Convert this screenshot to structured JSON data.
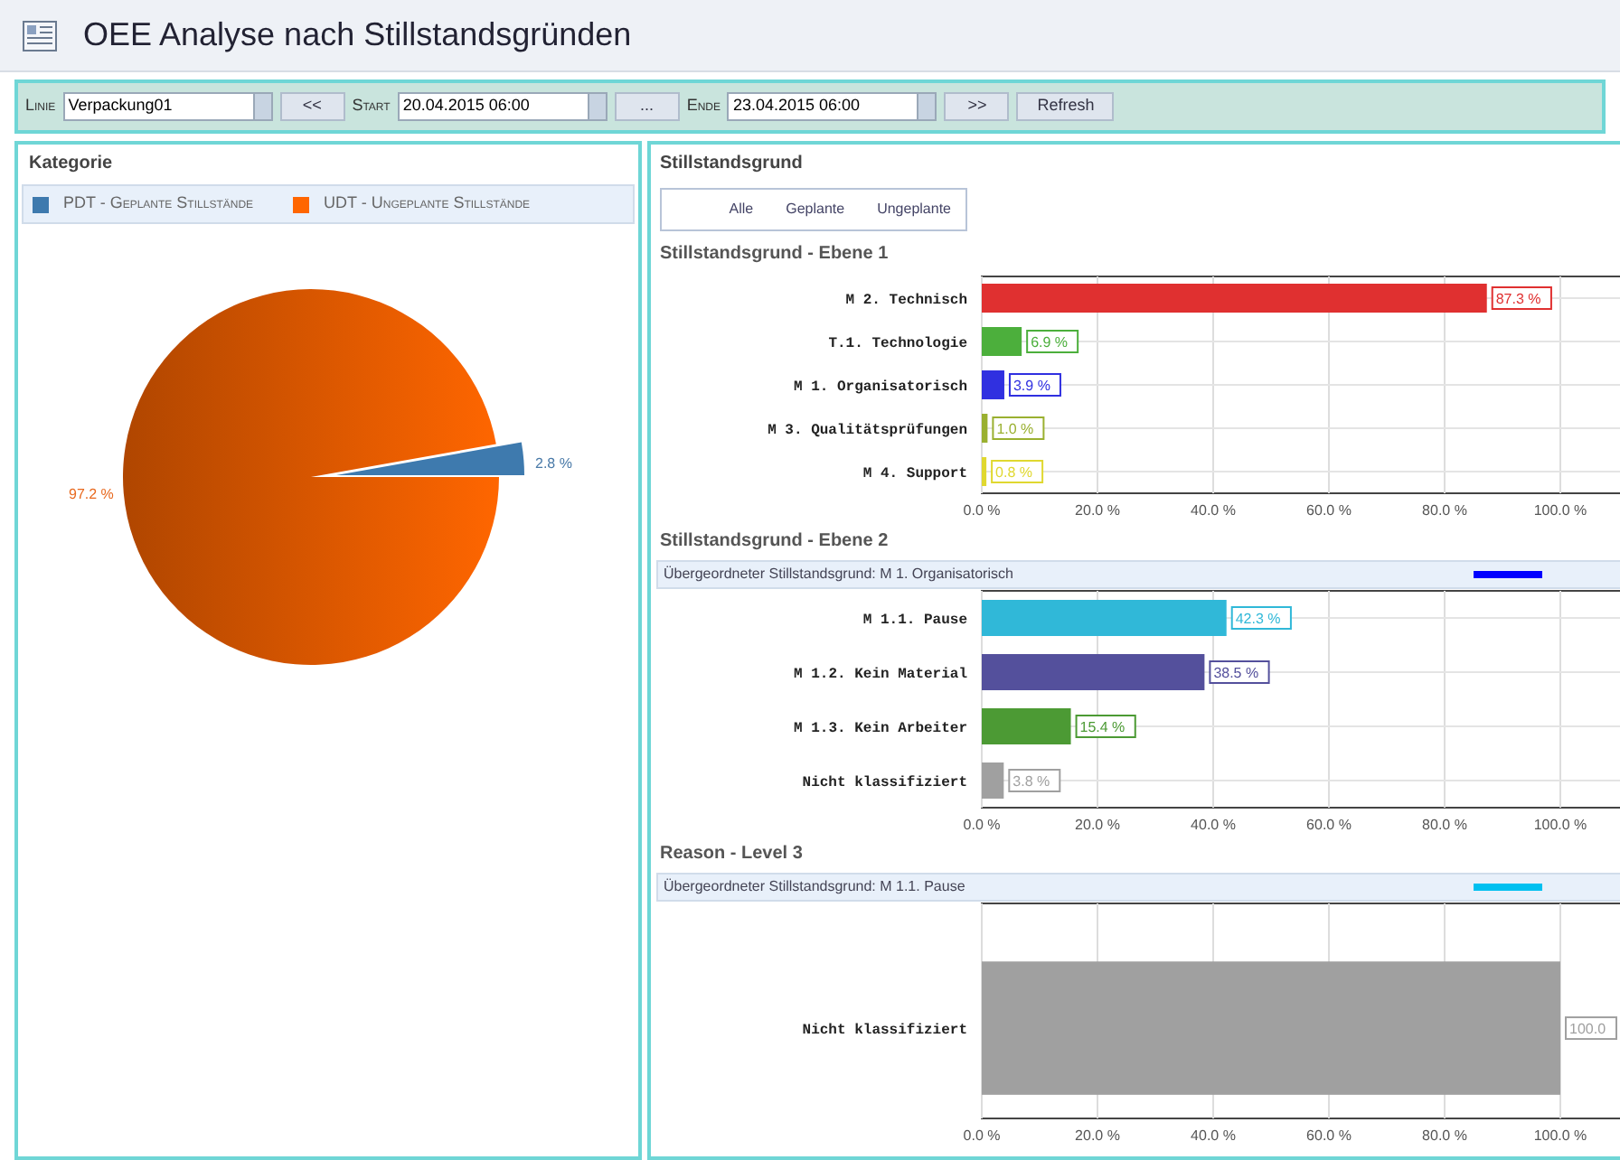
{
  "window": {
    "title": "OEE Analyse nach Stillstandsgründen"
  },
  "toolbar": {
    "line_label": "Linie",
    "line_value": "Verpackung01",
    "prev_button": "<<",
    "start_label": "Start",
    "start_value": "20.04.2015 06:00",
    "pick_button": "...",
    "end_label": "Ende",
    "end_value": "23.04.2015 06:00",
    "next_button": ">>",
    "refresh_button": "Refresh"
  },
  "category_panel": {
    "title": "Kategorie",
    "legend": [
      {
        "label": "PDT - Geplante Stillstände",
        "color": "#3e7aae"
      },
      {
        "label": "UDT - Ungeplante Stillstände",
        "color": "#ff6600"
      }
    ],
    "chart_data": {
      "type": "pie",
      "values": [
        2.8,
        97.2
      ],
      "value_labels": [
        "2.8 %",
        "97.2 %"
      ]
    }
  },
  "reason_panel": {
    "title": "Stillstandsgrund",
    "filters": [
      "Alle",
      "Geplante",
      "Ungeplante"
    ],
    "sections": [
      {
        "title": "Stillstandsgrund - Ebene 1",
        "chart_data": {
          "type": "bar",
          "orientation": "horizontal",
          "categories": [
            "M 2. Technisch",
            "T.1. Technologie",
            "M 1. Organisatorisch",
            "M 3. Qualitätsprüfungen",
            "M 4. Support"
          ],
          "values": [
            87.3,
            6.9,
            3.9,
            1.0,
            0.8
          ],
          "colors": [
            "#e03030",
            "#4caf3c",
            "#3030e0",
            "#9ab030",
            "#e0d830"
          ],
          "value_labels": [
            "87.3 %",
            "6.9 %",
            "3.9 %",
            "1.0 %",
            "0.8 %"
          ],
          "grid": true,
          "xlim": [
            0,
            112.5
          ],
          "xticks": [
            {
              "value": 0,
              "label": "0.0 %"
            },
            {
              "value": 20,
              "label": "20.0 %"
            },
            {
              "value": 40,
              "label": "40.0 %"
            },
            {
              "value": 60,
              "label": "60.0 %"
            },
            {
              "value": 80,
              "label": "80.0 %"
            },
            {
              "value": 100,
              "label": "100.0 %"
            }
          ]
        }
      },
      {
        "title": "Stillstandsgrund - Ebene 2",
        "parent": {
          "label": "Übergeordneter Stillstandsgrund: M 1. Organisatorisch",
          "color": "#0000ff"
        },
        "chart_data": {
          "type": "bar",
          "orientation": "horizontal",
          "categories": [
            "M 1.1. Pause",
            "M 1.2. Kein Material",
            "M 1.3. Kein Arbeiter",
            "Nicht klassifiziert"
          ],
          "values": [
            42.3,
            38.5,
            15.4,
            3.8
          ],
          "colors": [
            "#30b8d8",
            "#54509c",
            "#4c9a34",
            "#a0a0a0"
          ],
          "value_labels": [
            "42.3 %",
            "38.5 %",
            "15.4 %",
            "3.8 %"
          ],
          "grid": true,
          "xlim": [
            0,
            112.5
          ],
          "xticks": [
            {
              "value": 0,
              "label": "0.0 %"
            },
            {
              "value": 20,
              "label": "20.0 %"
            },
            {
              "value": 40,
              "label": "40.0 %"
            },
            {
              "value": 60,
              "label": "60.0 %"
            },
            {
              "value": 80,
              "label": "80.0 %"
            },
            {
              "value": 100,
              "label": "100.0 %"
            }
          ]
        }
      },
      {
        "title": "Reason - Level 3",
        "parent": {
          "label": "Übergeordneter Stillstandsgrund: M 1.1. Pause",
          "color": "#00c0f0"
        },
        "chart_data": {
          "type": "bar",
          "orientation": "horizontal",
          "categories": [
            "Nicht klassifiziert"
          ],
          "values": [
            100.0
          ],
          "colors": [
            "#a0a0a0"
          ],
          "value_labels": [
            "100.0"
          ],
          "grid": true,
          "xlim": [
            0,
            112.5
          ],
          "xticks": [
            {
              "value": 0,
              "label": "0.0 %"
            },
            {
              "value": 20,
              "label": "20.0 %"
            },
            {
              "value": 40,
              "label": "40.0 %"
            },
            {
              "value": 60,
              "label": "60.0 %"
            },
            {
              "value": 80,
              "label": "80.0 %"
            },
            {
              "value": 100,
              "label": "100.0 %"
            }
          ]
        }
      }
    ]
  }
}
